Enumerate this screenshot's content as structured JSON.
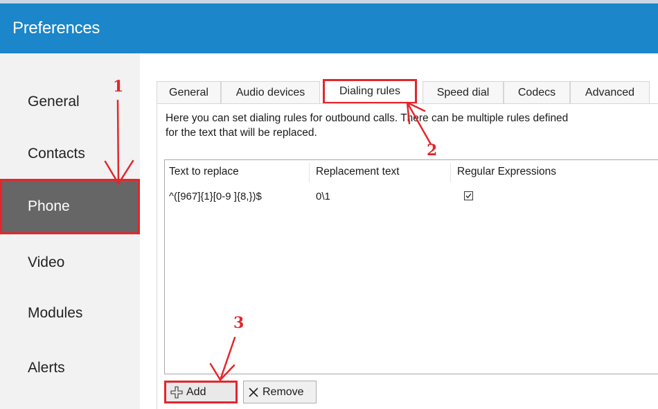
{
  "window": {
    "title": "Preferences"
  },
  "sidebar": {
    "items": [
      {
        "label": "General",
        "active": false
      },
      {
        "label": "Contacts",
        "active": false
      },
      {
        "label": "Phone",
        "active": true
      },
      {
        "label": "Video",
        "active": false
      },
      {
        "label": "Modules",
        "active": false
      },
      {
        "label": "Alerts",
        "active": false
      }
    ]
  },
  "tabs": [
    {
      "label": "General",
      "active": false
    },
    {
      "label": "Audio devices",
      "active": false
    },
    {
      "label": "Dialing rules",
      "active": true
    },
    {
      "label": "Speed dial",
      "active": false
    },
    {
      "label": "Codecs",
      "active": false
    },
    {
      "label": "Advanced",
      "active": false
    }
  ],
  "dialing_rules": {
    "description_line1": "Here you can set dialing rules for outbound calls. There can be multiple rules defined",
    "description_line2": "for the text that will be replaced.",
    "columns": [
      "Text to replace",
      "Replacement text",
      "Regular Expressions"
    ],
    "rows": [
      {
        "text_to_replace": "^([967]{1}[0-9 ]{8,})$",
        "replacement_text": "0\\1",
        "regular_expressions": true
      }
    ],
    "add_label": "Add",
    "remove_label": "Remove"
  },
  "annotations": {
    "step1": "1",
    "step2": "2",
    "step3": "3"
  },
  "colors": {
    "header": "#1b86c9",
    "sidebar_active": "#666666",
    "highlight": "#e3262b"
  },
  "icons": {
    "add": "plus-icon",
    "remove": "x-icon",
    "checkbox": "checkmark-icon"
  }
}
